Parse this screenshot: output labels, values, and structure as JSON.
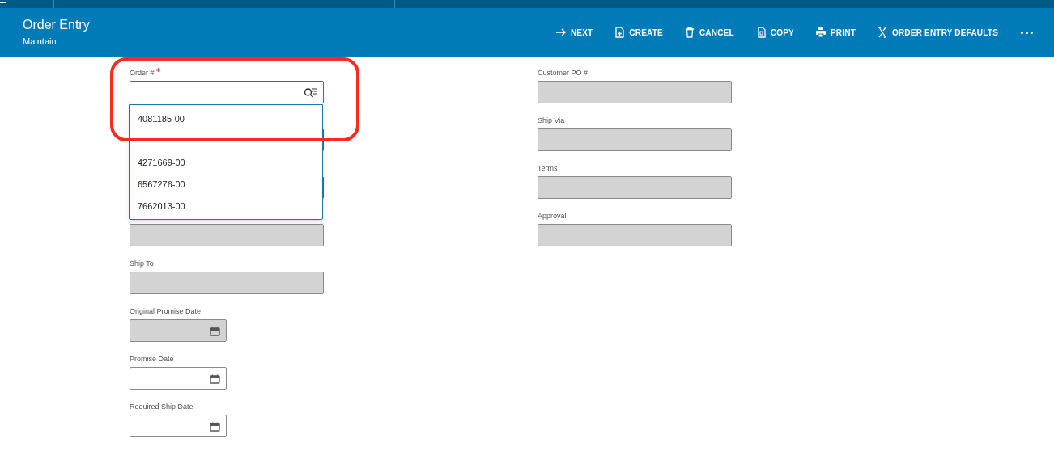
{
  "header": {
    "title": "Order Entry",
    "subtitle": "Maintain"
  },
  "toolbar": [
    {
      "kind": "next",
      "label": "NEXT"
    },
    {
      "kind": "create",
      "label": "CREATE"
    },
    {
      "kind": "cancel",
      "label": "CANCEL"
    },
    {
      "kind": "copy",
      "label": "COPY"
    },
    {
      "kind": "print",
      "label": "PRINT"
    },
    {
      "kind": "defaults",
      "label": "ORDER ENTRY DEFAULTS"
    },
    {
      "kind": "more"
    }
  ],
  "left_fields": [
    {
      "kind": "lookup",
      "label": "Order #",
      "required": true,
      "focused": true
    },
    {
      "kind": "text",
      "disabled": false
    },
    {
      "kind": "text",
      "disabled": false
    },
    {
      "kind": "text",
      "disabled": true
    },
    {
      "kind": "text",
      "label": "Ship To",
      "disabled": true
    },
    {
      "kind": "date",
      "label": "Original Promise Date",
      "disabled": true
    },
    {
      "kind": "date",
      "label": "Promise Date",
      "disabled": false
    },
    {
      "kind": "date",
      "label": "Required Ship Date",
      "disabled": false
    }
  ],
  "right_fields": [
    {
      "kind": "text",
      "label": "Customer PO #",
      "disabled": true
    },
    {
      "kind": "text",
      "label": "Ship Via",
      "disabled": true
    },
    {
      "kind": "text",
      "label": "Terms",
      "disabled": true
    },
    {
      "kind": "text",
      "label": "Approval",
      "disabled": true
    }
  ],
  "dropdown": {
    "options": [
      {
        "kind": "option",
        "label": "4081185-00"
      },
      {
        "kind": "covered"
      },
      {
        "kind": "option",
        "label": "4271669-00"
      },
      {
        "kind": "option",
        "label": "6567276-00"
      },
      {
        "kind": "option",
        "label": "7662013-00"
      }
    ]
  },
  "annotation": {
    "kind": "outline",
    "color": "#ff2a1f"
  }
}
